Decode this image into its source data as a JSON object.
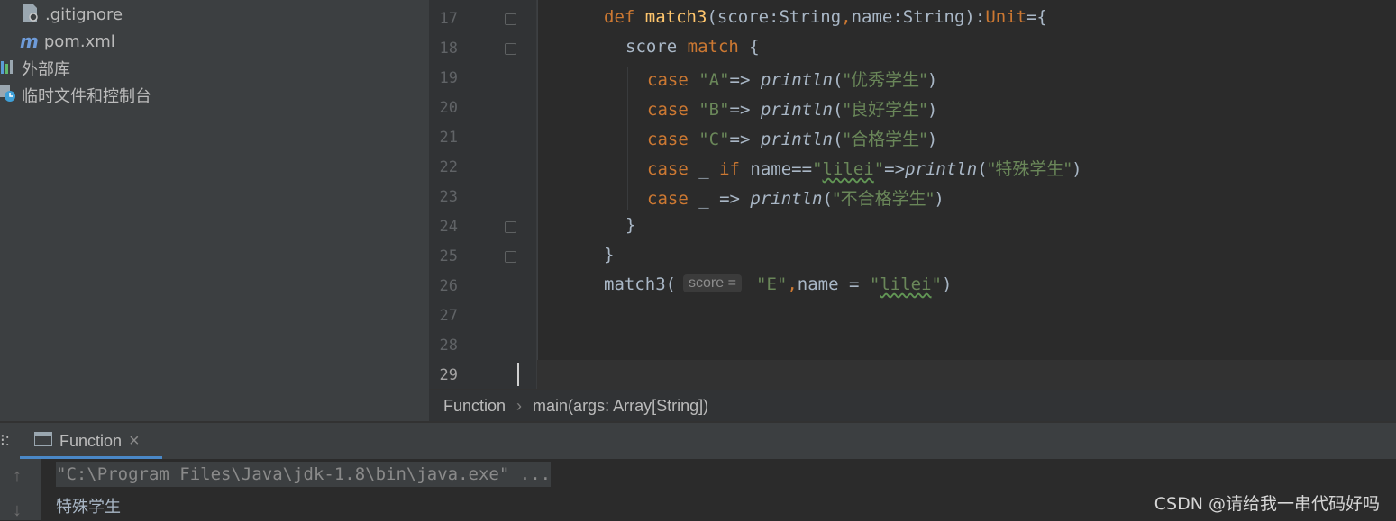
{
  "tree": {
    "items": [
      {
        "label": ".gitignore",
        "icon": "gitignore-file-icon"
      },
      {
        "label": "pom.xml",
        "icon": "maven-m-icon"
      },
      {
        "label": "外部库",
        "icon": "library-bars-icon"
      },
      {
        "label": "临时文件和控制台",
        "icon": "scratch-console-icon"
      }
    ]
  },
  "editor": {
    "line_numbers": [
      "17",
      "18",
      "19",
      "20",
      "21",
      "22",
      "23",
      "24",
      "25",
      "26",
      "27",
      "28",
      "29"
    ],
    "code": {
      "l17": {
        "def": "def",
        "name": "match3",
        "sig": "(score:String",
        "comma": ",",
        "sig2": "name:String):",
        "unit": "Unit",
        "eq": "={"
      },
      "l18": {
        "score": "score ",
        "match": "match",
        "brace": " {"
      },
      "l19": {
        "case": "case",
        "pat": "\"A\"",
        "arrow": "=> ",
        "fn": "println",
        "open": "(",
        "str": "\"优秀学生\"",
        "close": ")"
      },
      "l20": {
        "case": "case",
        "pat": "\"B\"",
        "arrow": "=> ",
        "fn": "println",
        "open": "(",
        "str": "\"良好学生\"",
        "close": ")"
      },
      "l21": {
        "case": "case",
        "pat": "\"C\"",
        "arrow": "=> ",
        "fn": "println",
        "open": "(",
        "str": "\"合格学生\"",
        "close": ")"
      },
      "l22": {
        "case": "case",
        "wild": " _ ",
        "if": "if",
        "cond": " name==",
        "q1": "\"",
        "lit": "lilei",
        "q2": "\"",
        "arrow": "=>",
        "fn": "println",
        "open": "(",
        "str": "\"特殊学生\"",
        "close": ")"
      },
      "l23": {
        "case": "case",
        "wild": " _ => ",
        "fn": "println",
        "open": "(",
        "str": "\"不合格学生\"",
        "close": ")"
      },
      "l24": {
        "text": "}"
      },
      "l25": {
        "text": "}"
      },
      "l26": {
        "call": "match3(",
        "hint": "score =",
        "arg1": "\"E\"",
        "comma": ",",
        "arg2": "name = ",
        "q1": "\"",
        "lit": "lilei",
        "q2": "\"",
        "close": ")"
      }
    }
  },
  "breadcrumb": {
    "item1": "Function",
    "sep": "›",
    "item2": "main(args: Array[String])"
  },
  "run": {
    "label_cut": "⁝:",
    "tab_label": "Function",
    "close": "×",
    "cmd": "\"C:\\Program Files\\Java\\jdk-1.8\\bin\\java.exe\" ...",
    "output": "特殊学生",
    "up": "↑",
    "down": "↓"
  },
  "watermark": "CSDN @请给我一串代码好吗"
}
